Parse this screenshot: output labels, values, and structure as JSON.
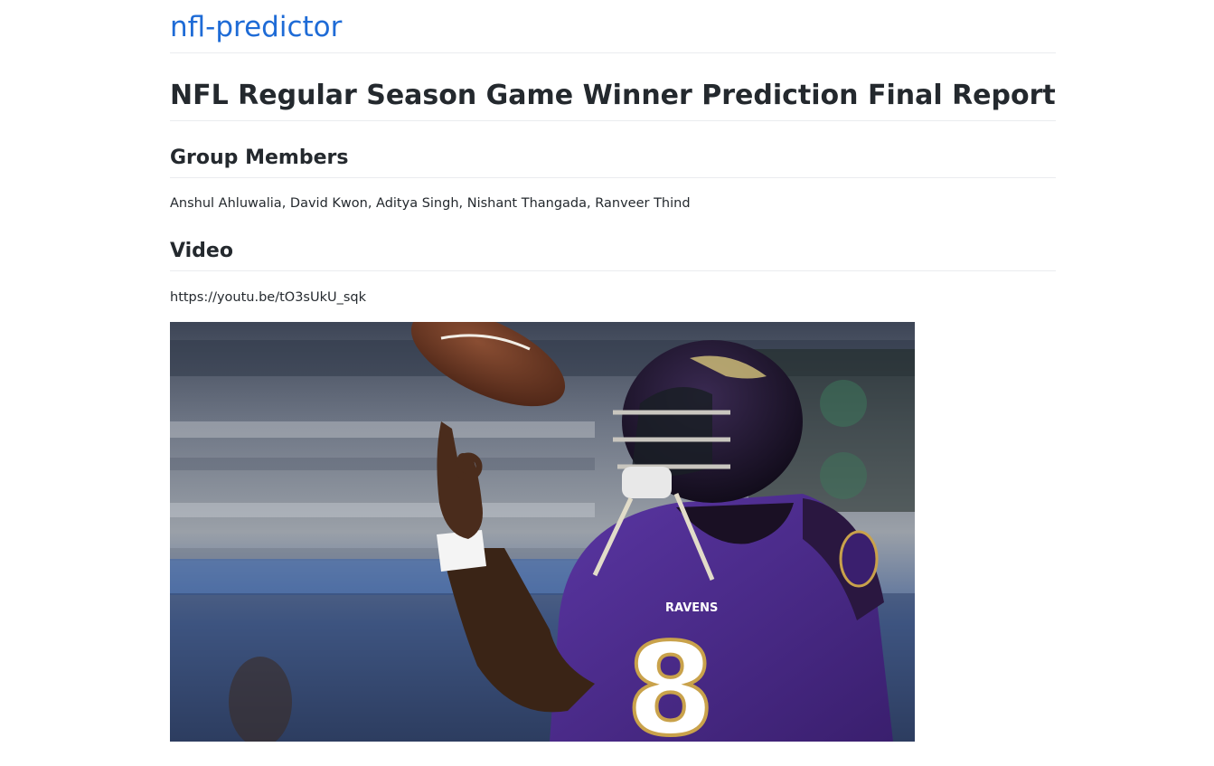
{
  "site": {
    "title": "nfl-predictor"
  },
  "report": {
    "title": "NFL Regular Season Game Winner Prediction Final Report"
  },
  "members": {
    "heading": "Group Members",
    "names": "Anshul Ahluwalia, David Kwon, Aditya Singh, Nishant Thangada, Ranveer Thind"
  },
  "video": {
    "heading": "Video",
    "link": "https://youtu.be/tO3sUkU_sqk"
  },
  "hero_image": {
    "jersey_text": "RAVENS",
    "jersey_number": "8",
    "colors": {
      "jersey": "#4b2a8a",
      "helmet": "#1b1226",
      "ball": "#6b3b26"
    }
  }
}
